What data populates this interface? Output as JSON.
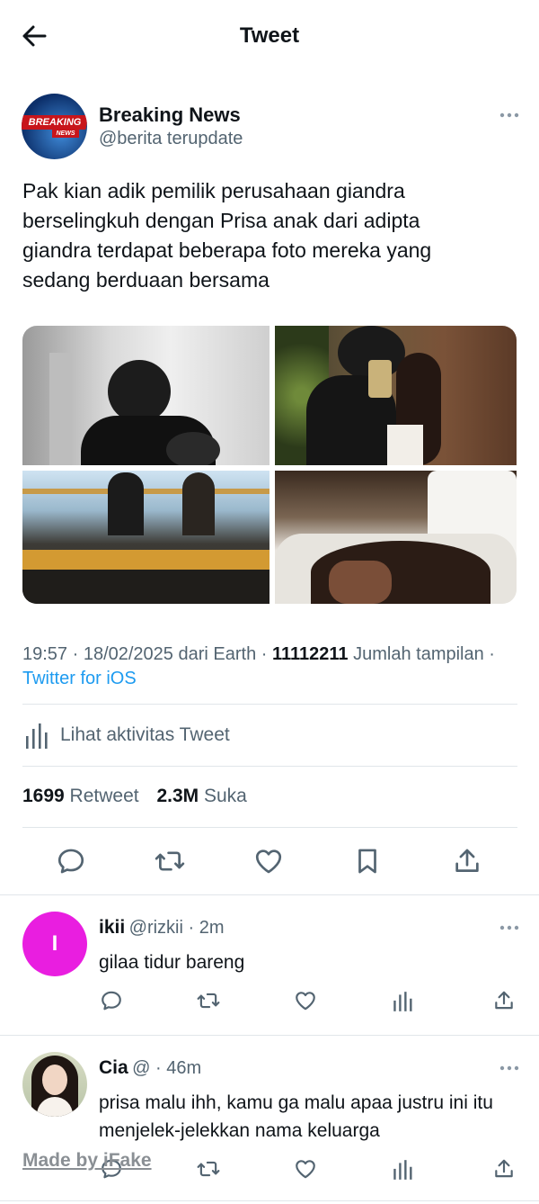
{
  "header": {
    "title": "Tweet",
    "back_icon": "arrow-left-icon"
  },
  "tweet": {
    "author_name": "Breaking News",
    "author_handle": "@berita terupdate",
    "avatar_text": "BREAKING",
    "avatar_subtext": "NEWS",
    "text": "Pak kian adik pemilik perusahaan giandra berselingkuh dengan Prisa anak dari adipta giandra terdapat beberapa foto mereka yang sedang berduaan bersama",
    "time_prefix": "19:57 · 18/02/2025 dari Earth · ",
    "views_count": "11112211",
    "views_label": " Jumlah tampilan · ",
    "source": "Twitter for iOS",
    "activity_label": "Lihat aktivitas Tweet",
    "retweet_count": "1699",
    "retweet_label": " Retweet",
    "like_count": "2.3M",
    "like_label": " Suka"
  },
  "replies": [
    {
      "name": "ikii",
      "meta": "@rizkii · 2m",
      "avatar_letter": "I",
      "avatar_color": "#e91ee0",
      "text": "gilaa tidur bareng"
    },
    {
      "name": "Cia",
      "meta": "@ · 46m",
      "text": "prisa malu ihh, kamu ga malu apaa justru ini itu menjelek-jelekkan nama keluarga"
    }
  ],
  "watermark": "Made by iFake",
  "colors": {
    "accent": "#1d9bf0",
    "muted": "#536471",
    "border": "#e1e6ea"
  }
}
